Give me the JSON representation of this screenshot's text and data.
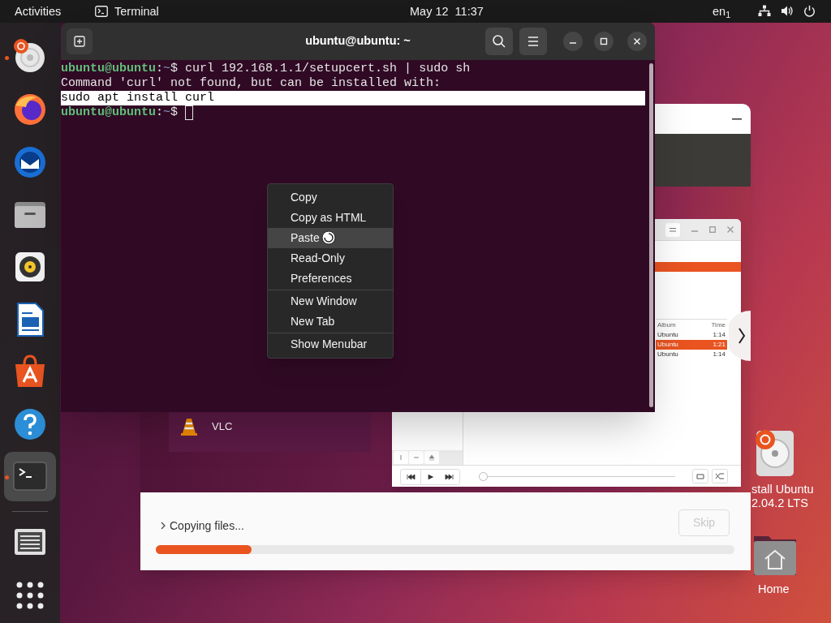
{
  "top_bar": {
    "activities": "Activities",
    "app_name": "Terminal",
    "clock": "May 12  11:37",
    "keyboard_layout": "en$_{1}$"
  },
  "dock": {
    "items": [
      {
        "kind": "installer",
        "running": true,
        "selected": false
      },
      {
        "kind": "firefox",
        "running": false,
        "selected": false
      },
      {
        "kind": "mail",
        "running": false,
        "selected": false
      },
      {
        "kind": "files",
        "running": false,
        "selected": false
      },
      {
        "kind": "music",
        "running": false,
        "selected": false
      },
      {
        "kind": "writer",
        "running": false,
        "selected": false
      },
      {
        "kind": "store",
        "running": false,
        "selected": false
      },
      {
        "kind": "help",
        "running": false,
        "selected": false
      },
      {
        "kind": "terminal",
        "running": true,
        "selected": true
      },
      {
        "kind": "separator"
      },
      {
        "kind": "screen",
        "running": false,
        "selected": false
      },
      {
        "kind": "apps",
        "running": false,
        "selected": false
      }
    ]
  },
  "desktop_icons": [
    {
      "kind": "installer",
      "lines": [
        "stall Ubuntu",
        "2.04.2 LTS"
      ]
    },
    {
      "kind": "home",
      "lines": [
        "Home"
      ]
    }
  ],
  "installer_window": {
    "slideshow": {
      "app_label": "VLC",
      "player": {
        "columns": [
          "Album",
          "Time"
        ],
        "rows": [
          {
            "album": "Ubuntu",
            "time": "1:14",
            "selected": false
          },
          {
            "album": "Ubuntu",
            "time": "1:21",
            "selected": true
          },
          {
            "album": "Ubuntu",
            "time": "1:14",
            "selected": false
          }
        ],
        "seek": {
          "level": 0
        }
      }
    },
    "status": "Copying files...",
    "skip_button": {
      "label": "Skip",
      "disabled": true
    },
    "progress": {
      "level": 0.165
    }
  },
  "terminal": {
    "title": "ubuntu@ubuntu: ~",
    "lines": [
      {
        "kind": "command",
        "user": "ubuntu@ubuntu",
        "separator": ":",
        "dir": "~",
        "sign": "$",
        "text": "curl 192.168.1.1/setupcert.sh | sudo sh",
        "selected": false
      },
      {
        "kind": "output",
        "text": "Command 'curl' not found, but can be installed with:",
        "selected": false
      },
      {
        "kind": "output",
        "text": "sudo apt install curl",
        "selected": true
      },
      {
        "kind": "command",
        "user": "ubuntu@ubuntu",
        "separator": ":",
        "dir": "~",
        "sign": "$",
        "cursor": true,
        "selected": false
      }
    ]
  },
  "context_menu": {
    "sections": [
      [
        {
          "label": "Copy",
          "hovered": false
        },
        {
          "label": "Copy as HTML",
          "hovered": false
        },
        {
          "label": "Paste",
          "hovered": true
        },
        {
          "label": "Read-Only",
          "hovered": false
        },
        {
          "label": "Preferences",
          "hovered": false
        }
      ],
      [
        {
          "label": "New Window",
          "hovered": false
        },
        {
          "label": "New Tab",
          "hovered": false
        }
      ],
      [
        {
          "label": "Show Menubar",
          "hovered": false
        }
      ]
    ]
  }
}
